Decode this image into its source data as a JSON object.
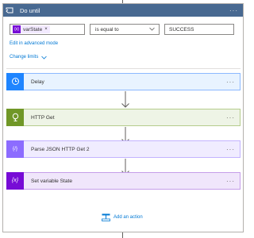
{
  "loop": {
    "title": "Do until",
    "menu": "···",
    "header_color": "#486991",
    "icon": "loop-icon"
  },
  "condition": {
    "left_token": {
      "icon_text": "{x}",
      "label": "varState",
      "remove": "×"
    },
    "operator": {
      "value": "is equal to",
      "icon": "chevron-down-icon"
    },
    "right_value": "SUCCESS"
  },
  "links": {
    "advanced_mode": "Edit in advanced mode",
    "change_limits": "Change limits",
    "change_limits_icon": "chevron-down-icon"
  },
  "actions": [
    {
      "title": "Delay",
      "menu": "···",
      "icon": "clock-icon",
      "color": "#1f85ff",
      "bg": "#e8f3ff"
    },
    {
      "title": "HTTP Get",
      "menu": "···",
      "icon": "globe-icon",
      "color": "#709727",
      "bg": "#eef4e6"
    },
    {
      "title": "Parse JSON HTTP Get 2",
      "menu": "···",
      "icon": "braces-icon",
      "color": "#8c6cff",
      "bg": "#f0ecff",
      "icon_text": "{/}"
    },
    {
      "title": "Set variable State",
      "menu": "···",
      "icon": "variable-icon",
      "color": "#770bd6",
      "bg": "#f0e6fb",
      "icon_text": "{x}"
    }
  ],
  "add_action": {
    "label": "Add an action",
    "icon": "add-action-icon"
  }
}
